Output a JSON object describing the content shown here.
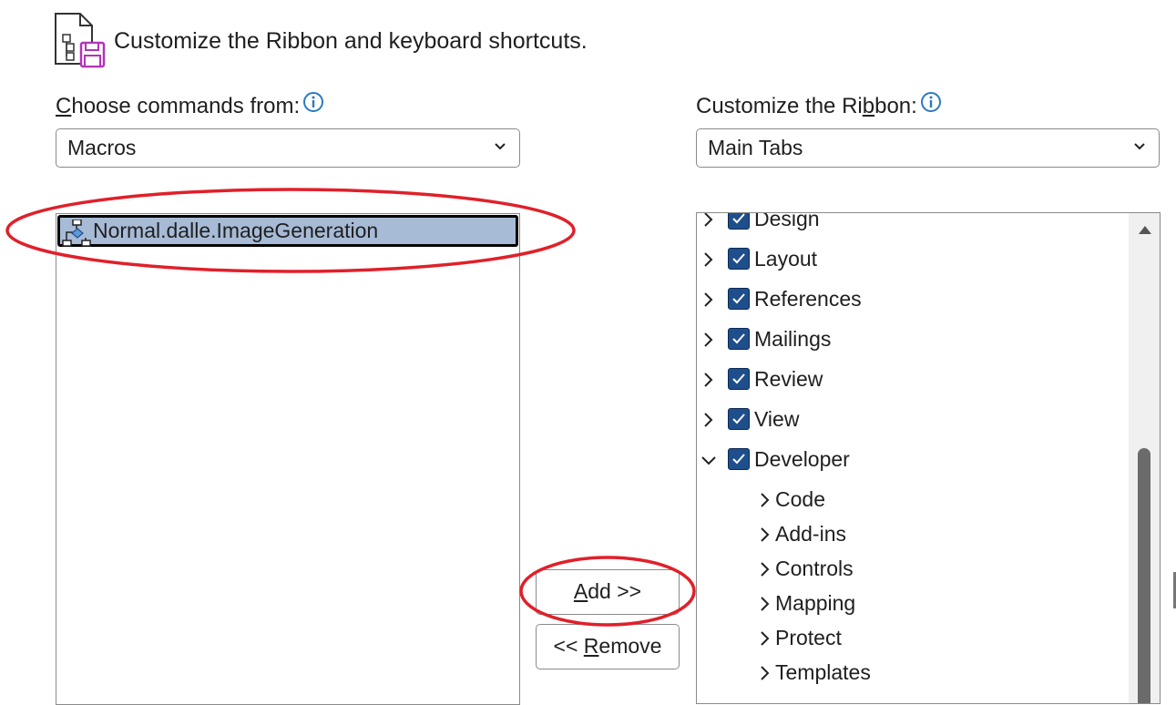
{
  "header": {
    "title": "Customize the Ribbon and keyboard shortcuts.",
    "icon": "customize-ribbon-icon"
  },
  "commands": {
    "label_prefix": "",
    "label_accel": "C",
    "label_rest": "hoose commands from:",
    "selected": "Macros",
    "items": [
      {
        "label": "Normal.dalle.ImageGeneration",
        "icon": "macro-icon",
        "selected": true
      }
    ]
  },
  "ribbon": {
    "label_prefix": "Customize the Ri",
    "label_accel": "b",
    "label_rest": "bon:",
    "selected": "Main Tabs",
    "tabs": [
      {
        "label": "Design",
        "checked": true,
        "expanded": false
      },
      {
        "label": "Layout",
        "checked": true,
        "expanded": false
      },
      {
        "label": "References",
        "checked": true,
        "expanded": false
      },
      {
        "label": "Mailings",
        "checked": true,
        "expanded": false
      },
      {
        "label": "Review",
        "checked": true,
        "expanded": false
      },
      {
        "label": "View",
        "checked": true,
        "expanded": false
      },
      {
        "label": "Developer",
        "checked": true,
        "expanded": true
      }
    ],
    "developer_groups": [
      "Code",
      "Add-ins",
      "Controls",
      "Mapping",
      "Protect",
      "Templates"
    ]
  },
  "buttons": {
    "add_accel": "A",
    "add_rest": "dd >>",
    "remove_prefix": "<< ",
    "remove_accel": "R",
    "remove_rest": "emove"
  },
  "colors": {
    "selection": "#a7bbd6",
    "checkbox": "#1f4e8c",
    "annotation": "#e0202a",
    "info": "#2a7ac0"
  }
}
